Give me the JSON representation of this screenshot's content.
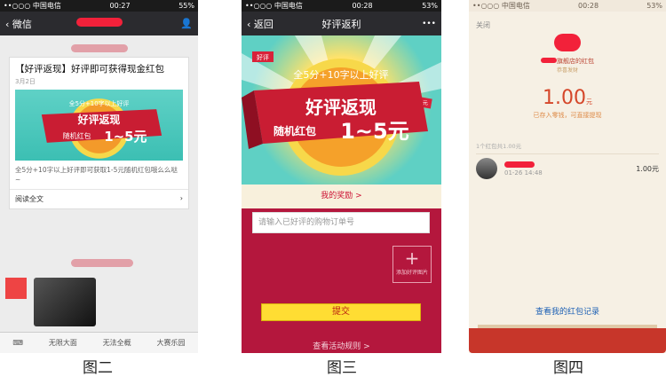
{
  "phone1": {
    "status": {
      "carrier": "••○○○ 中国电信",
      "time": "00:27",
      "battery": "55%"
    },
    "nav": {
      "back": "微信"
    },
    "card": {
      "title": "【好评返现】好评即可获得现金红包",
      "date": "3月2日",
      "banner_line1": "全5分+10字以上好评",
      "banner_line2": "好评返现",
      "banner_line3": "随机红包",
      "banner_line4": "1~5元",
      "desc": "全5分+10字以上好评即可获取1-5元随机红包哦么么哒~",
      "read_more": "阅读全文"
    },
    "bottom": {
      "item1": "无限大面",
      "item2": "无法全概",
      "item3": "大赛乐园"
    }
  },
  "phone2": {
    "status": {
      "carrier": "••○○○ 中国电信",
      "time": "00:28",
      "battery": "53%"
    },
    "nav": {
      "back": "返回",
      "title": "好评返利",
      "more": "•••"
    },
    "banner": {
      "tag": "好评",
      "small": "5元",
      "line1": "全5分+10字以上好评",
      "line2": "好评返现",
      "line3": "随机红包",
      "line4": "1~5元"
    },
    "my_reward": "我的奖励 >",
    "order_placeholder": "请输入已好评的购物订单号",
    "upload_plus": "+",
    "upload_label": "添加好评图片",
    "submit": "提交",
    "rules": "查看活动规则 >"
  },
  "phone3": {
    "status": {
      "carrier": "••○○○ 中国电信",
      "time": "00:28",
      "battery": "53%"
    },
    "close": "关闭",
    "shop_name": "旗舰店的红包",
    "shop_sub": "恭喜发财",
    "amount": "1.00",
    "amount_unit": "元",
    "saved": "已存入零钱，可直接提现",
    "count": "1个红包共1.00元",
    "record_time": "01-26 14:48",
    "record_amount": "1.00元",
    "history": "查看我的红包记录"
  },
  "captions": {
    "c1": "图二",
    "c2": "图三",
    "c3": "图四"
  }
}
